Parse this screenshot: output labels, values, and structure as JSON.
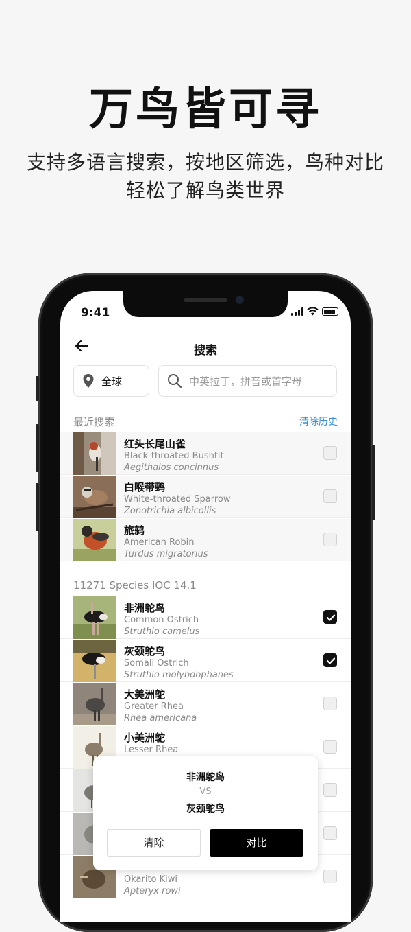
{
  "promo": {
    "headline": "万鸟皆可寻",
    "sub_line1": "支持多语言搜索，按地区筛选，鸟种对比",
    "sub_line2": "轻松了解鸟类世界"
  },
  "status_bar": {
    "time": "9:41"
  },
  "nav": {
    "title": "搜索",
    "back_icon": "arrow-left-icon"
  },
  "filters": {
    "region_label": "全球",
    "search_placeholder": "中英拉丁，拼音或首字母"
  },
  "recent": {
    "header": "最近搜索",
    "clear_label": "清除历史",
    "items": [
      {
        "cn": "红头长尾山雀",
        "en": "Black-throated Bushtit",
        "sci": "Aegithalos concinnus",
        "checked": false
      },
      {
        "cn": "白喉带鹀",
        "en": "White-throated Sparrow",
        "sci": "Zonotrichia albicollis",
        "checked": false
      },
      {
        "cn": "旅鸫",
        "en": "American Robin",
        "sci": "Turdus migratorius",
        "checked": false
      }
    ]
  },
  "species": {
    "header": "11271 Species  IOC 14.1",
    "items": [
      {
        "cn": "非洲鸵鸟",
        "en": "Common Ostrich",
        "sci": "Struthio camelus",
        "checked": true
      },
      {
        "cn": "灰颈鸵鸟",
        "en": "Somali Ostrich",
        "sci": "Struthio molybdophanes",
        "checked": true
      },
      {
        "cn": "大美洲鸵",
        "en": "Greater Rhea",
        "sci": "Rhea americana",
        "checked": false
      },
      {
        "cn": "小美洲鸵",
        "en": "Lesser Rhea",
        "sci": "",
        "checked": false
      },
      {
        "cn": "",
        "en": "",
        "sci": "",
        "checked": false
      },
      {
        "cn": "",
        "en": "",
        "sci": "",
        "checked": false
      },
      {
        "cn": "",
        "en": "Okarito Kiwi",
        "sci": "Apteryx rowi",
        "checked": false
      }
    ]
  },
  "compare": {
    "first": "非洲鸵鸟",
    "vs": "VS",
    "second": "灰颈鸵鸟",
    "clear_label": "清除",
    "compare_label": "对比"
  }
}
